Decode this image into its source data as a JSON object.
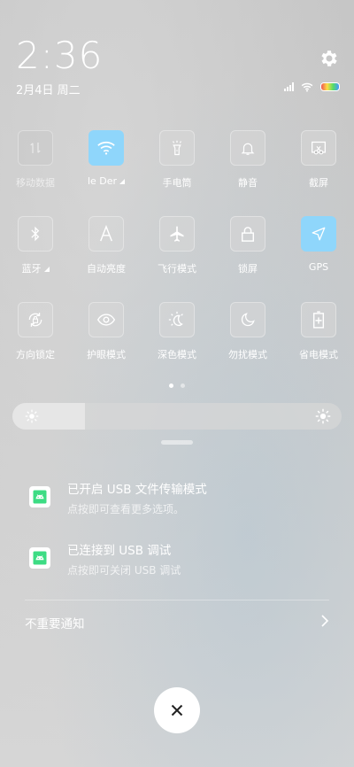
{
  "status": {
    "time": "2:36",
    "date": "2月4日 周二"
  },
  "tiles": [
    {
      "label": "移动数据",
      "icon": "mobile-data-icon",
      "state": "dim"
    },
    {
      "label": "le  Der",
      "icon": "wifi-icon",
      "state": "active",
      "has_dropdown": true
    },
    {
      "label": "手电筒",
      "icon": "flashlight-icon",
      "state": "off"
    },
    {
      "label": "静音",
      "icon": "bell-icon",
      "state": "off"
    },
    {
      "label": "截屏",
      "icon": "screenshot-icon",
      "state": "off"
    },
    {
      "label": "蓝牙",
      "icon": "bluetooth-icon",
      "state": "off",
      "has_dropdown": true
    },
    {
      "label": "自动亮度",
      "icon": "auto-brightness-icon",
      "state": "off"
    },
    {
      "label": "飞行模式",
      "icon": "airplane-icon",
      "state": "off"
    },
    {
      "label": "锁屏",
      "icon": "lock-icon",
      "state": "off"
    },
    {
      "label": "GPS",
      "icon": "location-icon",
      "state": "active"
    },
    {
      "label": "方向锁定",
      "icon": "rotation-lock-icon",
      "state": "off"
    },
    {
      "label": "护眼模式",
      "icon": "eye-icon",
      "state": "off"
    },
    {
      "label": "深色模式",
      "icon": "dark-mode-icon",
      "state": "off"
    },
    {
      "label": "勿扰模式",
      "icon": "moon-icon",
      "state": "off"
    },
    {
      "label": "省电模式",
      "icon": "battery-saver-icon",
      "state": "off"
    }
  ],
  "pager": {
    "page": 1,
    "pages": 2
  },
  "brightness": {
    "level": 0.22
  },
  "notifications": [
    {
      "title": "已开启 USB 文件传输模式",
      "subtitle": "点按即可查看更多选项。",
      "icon": "android-icon"
    },
    {
      "title": "已连接到 USB 调试",
      "subtitle": "点按即可关闭 USB 调试",
      "icon": "android-icon"
    }
  ],
  "unimportant": {
    "label": "不重要通知"
  },
  "colors": {
    "active_tile": "#8fd6fb",
    "android_green": "#3ddc84"
  }
}
